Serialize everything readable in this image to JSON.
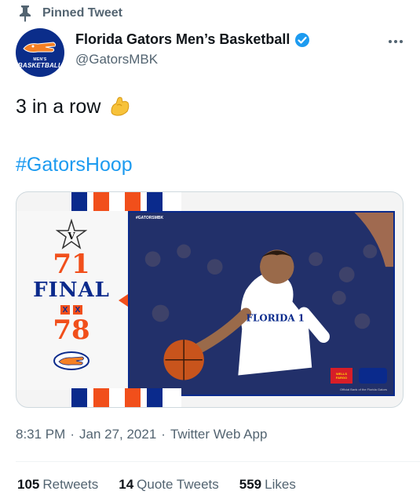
{
  "pinned": {
    "label": "Pinned Tweet"
  },
  "author": {
    "avatar_line1": "MEN'S",
    "avatar_line2": "BASKETBALL",
    "display_name": "Florida Gators Men’s Basketball",
    "handle": "@GatorsMBK"
  },
  "tweet": {
    "text": "3 in a row",
    "hashtag": "#GatorsHoop"
  },
  "media": {
    "away_score": "71",
    "status": "FINAL",
    "home_score": "78",
    "photo_tag": "#GATORSMBK",
    "sponsor": "WELLS FARGO",
    "jersey": "FLORIDA 1",
    "credit": "Official Bank of the Florida Gators"
  },
  "meta": {
    "time": "8:31 PM",
    "sep1": "·",
    "date": "Jan 27, 2021",
    "sep2": "·",
    "source": "Twitter Web App"
  },
  "stats": [
    {
      "count": "105",
      "label": "Retweets"
    },
    {
      "count": "14",
      "label": "Quote Tweets"
    },
    {
      "count": "559",
      "label": "Likes"
    }
  ],
  "colors": {
    "gator_blue": "#0a2a8c",
    "gator_orange": "#f14f1b",
    "link_blue": "#1d9bf0",
    "muted": "#536471"
  },
  "icons": {
    "pin": "pin-icon",
    "verified": "verified-badge-icon",
    "more": "more-options-icon",
    "emoji": "flexed-biceps-emoji"
  }
}
